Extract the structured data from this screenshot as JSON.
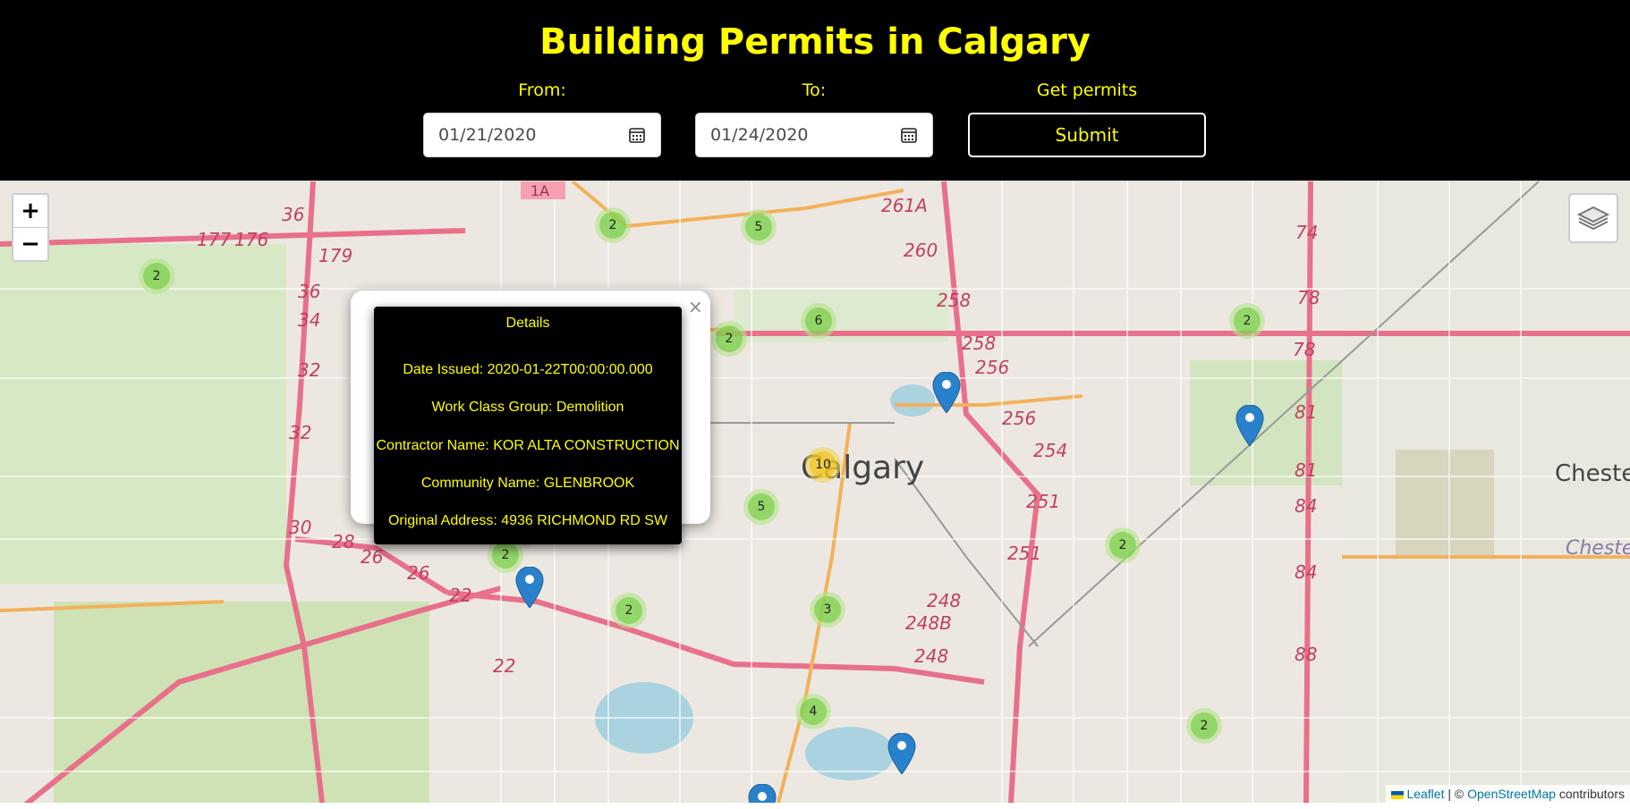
{
  "header": {
    "title": "Building Permits in Calgary",
    "from_label": "From:",
    "from_value": "01/21/2020",
    "to_label": "To:",
    "to_value": "01/24/2020",
    "get_label": "Get permits",
    "submit_label": "Submit"
  },
  "map": {
    "zoom_in": "+",
    "zoom_out": "−",
    "city_label": "Calgary",
    "place_label": "Cheste",
    "place_label_2": "Chester",
    "clusters": [
      "2",
      "5",
      "2",
      "2",
      "2",
      "6",
      "2",
      "10",
      "5",
      "2",
      "3",
      "2",
      "4",
      "2"
    ],
    "road_numbers": [
      "1A",
      "261A",
      "36",
      "177",
      "176",
      "179",
      "74",
      "260",
      "258",
      "78",
      "36",
      "34",
      "32",
      "32",
      "30",
      "28",
      "26",
      "26",
      "22",
      "22",
      "258",
      "256",
      "256",
      "254",
      "251",
      "251",
      "248",
      "248B",
      "248",
      "78",
      "81",
      "81",
      "84",
      "84",
      "88"
    ],
    "popup": {
      "close": "×",
      "title": "Details",
      "date_issued": "Date Issued: 2020-01-22T00:00:00.000",
      "work_class": "Work Class Group: Demolition",
      "contractor": "Contractor Name: KOR ALTA CONSTRUCTION",
      "community": "Community Name: GLENBROOK",
      "address": "Original Address: 4936 RICHMOND RD SW"
    },
    "attribution": {
      "leaflet": "Leaflet",
      "sep": " | © ",
      "osm": "OpenStreetMap",
      "contributors": " contributors"
    }
  }
}
